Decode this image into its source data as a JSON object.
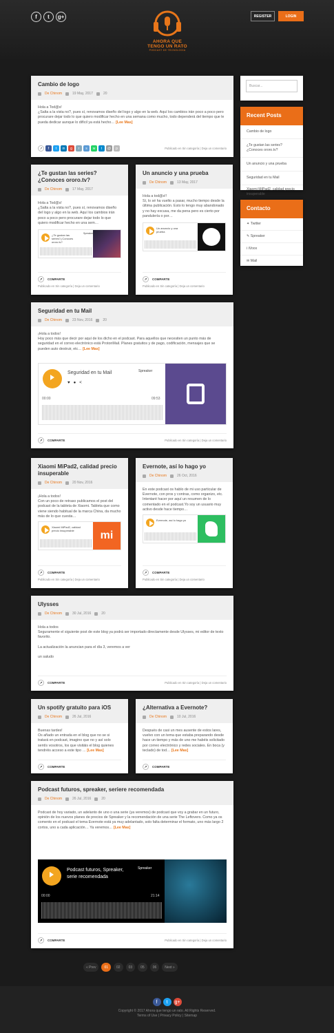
{
  "header": {
    "register": "REGISTER",
    "login": "LOGIN",
    "logo_title": "AHORA QUE TENGO UN RATO",
    "logo_sub": "PODCAST DE TECNOLOGIA",
    "social": [
      "f",
      "t",
      "g+"
    ]
  },
  "search": {
    "placeholder": "Buscar..."
  },
  "recent": {
    "title": "Recent Posts",
    "items": [
      "Cambio de logo",
      "¿Te gustan las series?¿Conoces ororo.tv?",
      "Un anuncio y una prueba",
      "Seguridad en tu Mail",
      "Xiaomi MiPad2, calidad precio insuperable"
    ]
  },
  "contact": {
    "title": "Contacto",
    "items": [
      "Twitter",
      "Spreaker",
      "iVoox",
      "Mail"
    ]
  },
  "common": {
    "author": "De Chinom",
    "share": "COMPARTE",
    "more": "[Lee Mas]",
    "posted": "Publicado en Sin categoría | Deja un comentario",
    "comments": "20"
  },
  "posts": [
    {
      "title": "Cambio de logo",
      "date": "19 May, 2017",
      "text": "Hola a Tod@s!\n¿Salta a la vista no?, pues sí, renovamos diseño del logo y algo en la web. Aquí los cambios irán poco a poco pero procurare dejar todo lo que quiero modificar hecho en una semana como mucho, todo dependerá del tiempo que le pueda dedicar aunque lo difícil ya está hecho…"
    },
    {
      "title": "¿Te gustan las series?¿Conoces ororo.tv?",
      "date": "17 May, 2017",
      "text": "Hola a Tod@s!\n¿Salta a la vista no?, pues sí, renovamos diseño del logo y algo en la web. Aquí los cambios irán poco a poco pero procurare dejar todo lo que quiero modificar hecho en una sem…",
      "player": "¿Te gustan las series?¿Conoces ororo.tv?"
    },
    {
      "title": "Un anuncio y una prueba",
      "date": "13 May, 2017",
      "text": "Hola a tod@s!!\nSí, lo sé ha vuelto a pasar, mucho tiempo desde la última publicación. Esto lo tengo muy abandonado y no hay excusa, me da pena pero es cierto por pandulería o por…",
      "player": "Un anuncio y una prueba"
    },
    {
      "title": "Seguridad en tu Mail",
      "date": "23 Nov, 2016",
      "text": "¡Hola a todos!\nHoy poco más que decir por aquí de los dicho en el podcast. Para aquellos que necesiten un punto más de seguridad en el correo electrónico está ProtonMail. Planes gratuitos y de pago, codificación, mensajes que se pueden auto destruir, etc…",
      "player": "Seguridad en tu Mail",
      "t0": "00:00",
      "t1": "09:53"
    },
    {
      "title": "Xiaomi MiPad2, calidad precio insuperable",
      "date": "20 Nov, 2016",
      "text": "¡Hola a todos!\nCon un poco de retraso publicamos el post del podcast de la tableta de Xiaomi. Tableta que como viene siendo habitual de la marca China, da mucho más de lo que cuesta…",
      "player": "Xiaomi MiPad2, calidad precio insuperable"
    },
    {
      "title": "Evernote, así lo hago yo",
      "date": "26 Oct, 2016",
      "text": "En este podcast os hablo de mi uso particular de Evernote, con pros y contras, como organizo, etc. Intentaré hacer por aquí un resumen de lo comentado en el podcast.Yo soy un usuario muy activo desde hace tiempo…",
      "player": "Evernote, así lo hago yo"
    },
    {
      "title": "Ulysses",
      "date": "30 Jul, 2016",
      "text": "Hola a todos\nSeguramente el siguiente post de este blog ya podrá ser importado directamente desde Ulysses, mi editor de texto favorito.\n\nLa actualización la anuncian para el día 3, veremos a ver\n\nun saludo"
    },
    {
      "title": "Un spotify gratuito para iOS",
      "date": "26 Jul, 2016",
      "text": "Buenas tardes!\nOs añado un entrada en el blog que no se si tratará en podcast, imagino que no y así solo sentís vosotros, los que visitáis el blog quienes tendréis acceso a este tipo …"
    },
    {
      "title": "¿Alternativa a Evernote?",
      "date": "10 Jul, 2016",
      "text": "Después de casi un mes ausente de estos lares, vuelvo con un tema que estaba preparando desde hace un tiempo y más de uno me habéis solicitado por correo electrónico y redes sociales. En boca (y teclado) de tod…"
    },
    {
      "title": "Podcast futuros, spreaker, seriere recomendada",
      "date": "26 Jul, 2016",
      "text": "Podcast de hoy variado, un adelanto de uno o una serie (ya veremos) de podcast que voy a grabar en un futuro, opinión de los nuevos planes de precios de Spreaker y la recomendación de una serie The Leftovers. Como ya os comento en el podcast el tema Evernote está ya muy adelantado, solo falta determinar el formato, uno más largo 2 cortos, uno a cada aplicación… Ya veremos…",
      "player": "Podcast futuros, Spreaker, serie recomendada",
      "t0": "00:00",
      "t1": "21:14"
    }
  ],
  "pagination": [
    "« Prev",
    "01",
    "02",
    "03",
    "05",
    "06",
    "Next »"
  ],
  "footer": {
    "copyright": "Copyright © 2017 Ahora que tengo un rato. All Rights Reserved.",
    "links": "Terms of Use  |  Privacy Policy  |  Sitemap"
  },
  "colors": {
    "accent": "#ea6e18",
    "play": "#f3a520"
  },
  "spreaker": "Spreaker"
}
